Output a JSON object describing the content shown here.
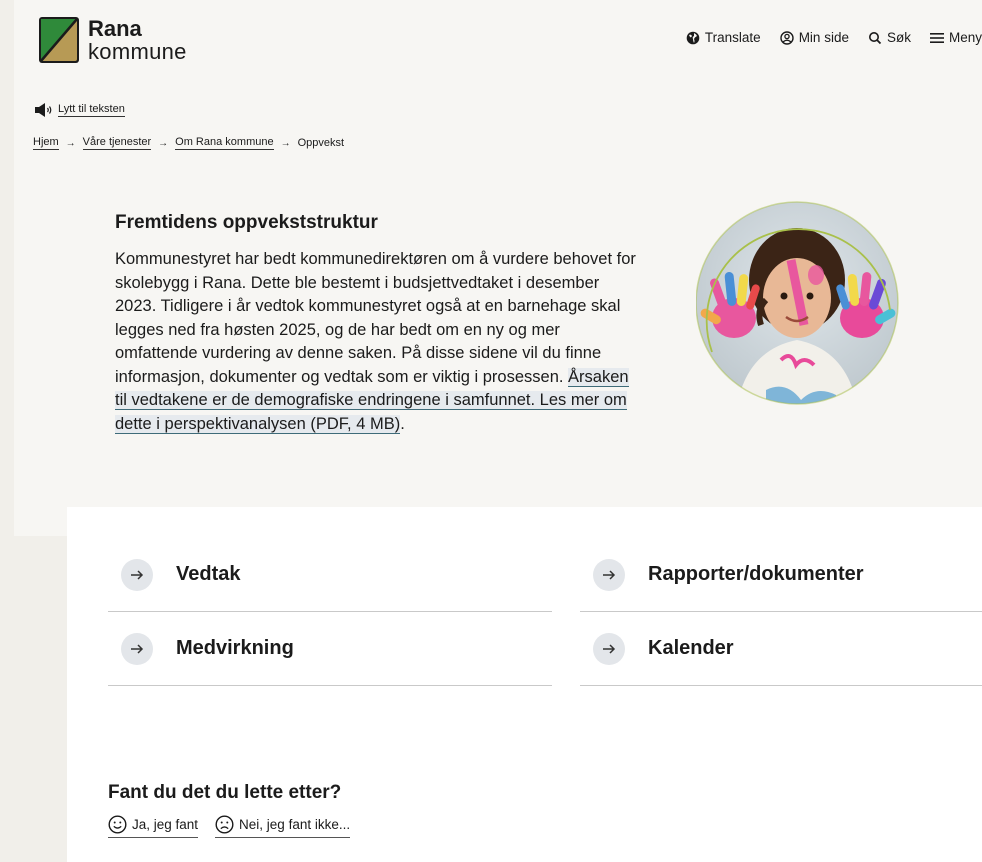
{
  "header": {
    "logo_name": "Rana",
    "logo_sub": "kommune",
    "nav": [
      {
        "label": "Translate",
        "icon": "globe-icon"
      },
      {
        "label": "Min side",
        "icon": "user-icon"
      },
      {
        "label": "Søk",
        "icon": "search-icon"
      },
      {
        "label": "Meny",
        "icon": "menu-icon"
      }
    ]
  },
  "listen": {
    "label": "Lytt til teksten",
    "icon": "speaker-icon"
  },
  "breadcrumb": {
    "items": [
      "Hjem",
      "Våre tjenester",
      "Om Rana kommune",
      "Oppvekst"
    ],
    "separator": "→"
  },
  "intro": {
    "title": "Fremtidens oppvekststruktur",
    "text": "Kommunestyret har bedt kommunedirektøren om å vurdere behovet for skolebygg i Rana. Dette ble bestemt i budsjettvedtaket i desember 2023. Tidligere i år vedtok kommunestyret også at en barnehage skal legges ned fra høsten 2025, og de har bedt om en ny og mer omfattende vurdering av denne saken. På disse sidene vil du finne informasjon,  dokumenter og vedtak som er viktig i prosessen. ",
    "link_text": "Årsaken til vedtakene er de demografiske endringene i samfunnet. Les mer om dette i perspektivanalysen (PDF, 4 MB)",
    "trailing": "."
  },
  "links": [
    {
      "label": "Vedtak"
    },
    {
      "label": "Rapporter/dokumenter"
    },
    {
      "label": "Medvirkning"
    },
    {
      "label": "Kalender"
    }
  ],
  "feedback": {
    "question": "Fant du det du lette etter?",
    "yes": "Ja, jeg fant",
    "no": "Nei, jeg fant ikke..."
  },
  "colors": {
    "logo_green": "#2f8a3a",
    "logo_gold": "#b79a55",
    "link_underline": "#3e6b79",
    "arrow_bg": "#e3e6ea",
    "photo_ring": "#a9c04a"
  }
}
